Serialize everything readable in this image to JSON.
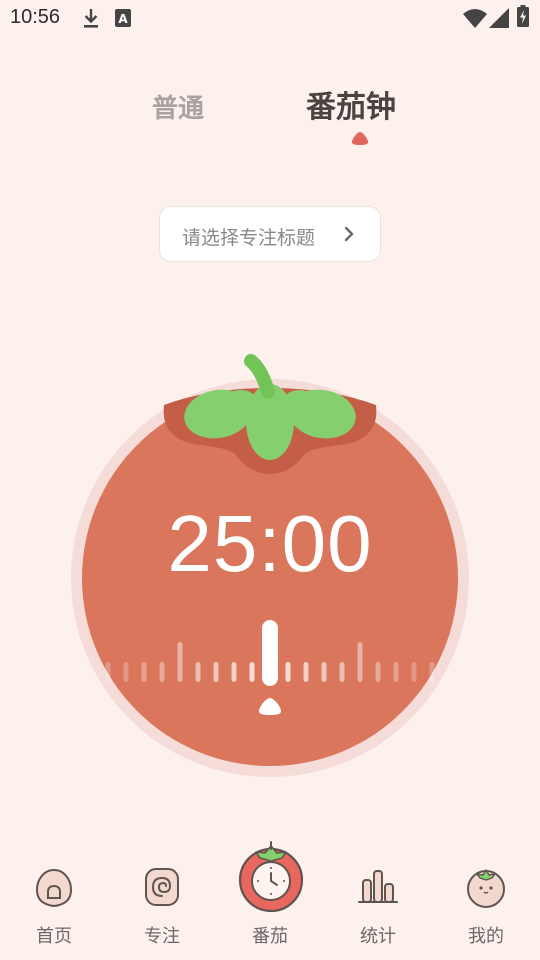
{
  "status_bar": {
    "time": "10:56"
  },
  "mode_tabs": {
    "normal": "普通",
    "pomodoro": "番茄钟",
    "active": "pomodoro"
  },
  "topic_selector": {
    "label": "请选择专注标题"
  },
  "timer": {
    "display": "25:00"
  },
  "bottom_nav": {
    "home": "首页",
    "focus": "专注",
    "tomato": "番茄",
    "stats": "统计",
    "mine": "我的",
    "active": "tomato"
  },
  "colors": {
    "background": "#fdf1ee",
    "tomato": "#d9765b",
    "leaf": "#86cf6e",
    "text_dark": "#4a4340",
    "text_muted": "#a8a3a0"
  }
}
